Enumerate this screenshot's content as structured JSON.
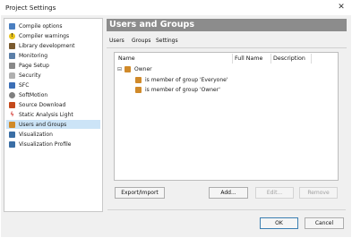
{
  "window": {
    "title": "Project Settings",
    "close_glyph": "✕"
  },
  "sidebar": {
    "items": [
      {
        "label": "Compile options",
        "icon": "compile-options-icon",
        "color": "#4a7fc1",
        "glyph": ""
      },
      {
        "label": "Compiler warnings",
        "icon": "warning-icon",
        "color": "#e8c21a",
        "glyph": "!"
      },
      {
        "label": "Library development",
        "icon": "library-icon",
        "color": "#7a5a2e",
        "glyph": ""
      },
      {
        "label": "Monitoring",
        "icon": "monitoring-icon",
        "color": "#5b7fa8",
        "glyph": ""
      },
      {
        "label": "Page Setup",
        "icon": "printer-icon",
        "color": "#888888",
        "glyph": ""
      },
      {
        "label": "Security",
        "icon": "lock-icon",
        "color": "#b0b0b0",
        "glyph": ""
      },
      {
        "label": "SFC",
        "icon": "sfc-icon",
        "color": "#3b6fb6",
        "glyph": ""
      },
      {
        "label": "SoftMotion",
        "icon": "softmotion-icon",
        "color": "#7f7f7f",
        "glyph": ""
      },
      {
        "label": "Source Download",
        "icon": "source-download-icon",
        "color": "#c44a1c",
        "glyph": ""
      },
      {
        "label": "Static Analysis Light",
        "icon": "static-analysis-icon",
        "color": "#d9534f",
        "glyph": "ϟ"
      },
      {
        "label": "Users and Groups",
        "icon": "users-groups-icon",
        "color": "#d08a2a",
        "glyph": "",
        "selected": true
      },
      {
        "label": "Visualization",
        "icon": "visualization-icon",
        "color": "#3a6ea5",
        "glyph": ""
      },
      {
        "label": "Visualization Profile",
        "icon": "visualization-profile-icon",
        "color": "#3a6ea5",
        "glyph": ""
      }
    ]
  },
  "main": {
    "heading": "Users and Groups",
    "tabs": [
      {
        "label": "Users",
        "active": true
      },
      {
        "label": "Groups"
      },
      {
        "label": "Settings"
      }
    ],
    "columns": [
      "Name",
      "Full Name",
      "Description"
    ],
    "tree": {
      "expander": "⊟",
      "root": "Owner",
      "children": [
        "is member of group 'Everyone'",
        "is member of group 'Owner'"
      ]
    },
    "buttons": {
      "export_import": "Export/Import",
      "add": "Add...",
      "edit": "Edit...",
      "remove": "Remove"
    }
  },
  "footer": {
    "ok": "OK",
    "cancel": "Cancel"
  },
  "colors": {
    "selection": "#cce4f7",
    "header_bar": "#8c8c8c"
  }
}
